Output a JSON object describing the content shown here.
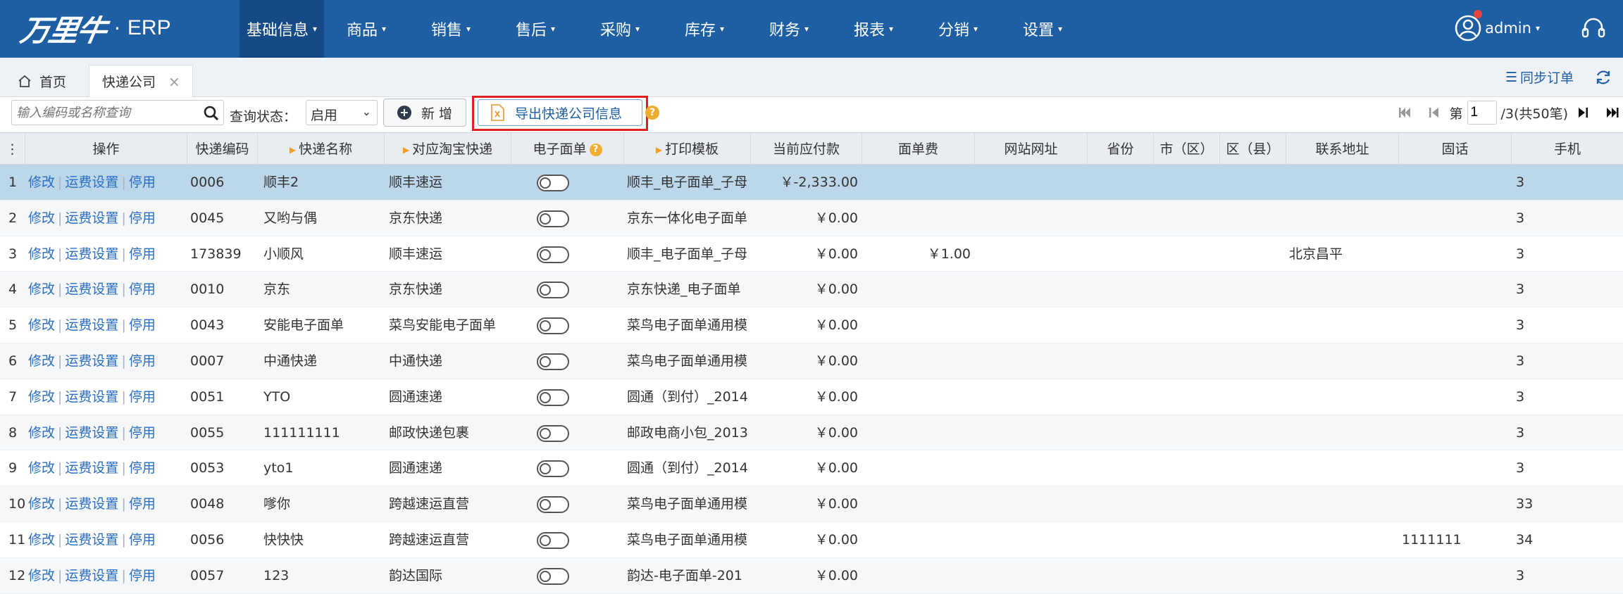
{
  "brand": {
    "logo_text": "万里牛",
    "dot": "·",
    "product": "ERP"
  },
  "nav": [
    {
      "label": "基础信息",
      "active": true
    },
    {
      "label": "商品"
    },
    {
      "label": "销售"
    },
    {
      "label": "售后"
    },
    {
      "label": "采购"
    },
    {
      "label": "库存"
    },
    {
      "label": "财务"
    },
    {
      "label": "报表"
    },
    {
      "label": "分销"
    },
    {
      "label": "设置"
    }
  ],
  "user": {
    "name": "admin"
  },
  "tabs": {
    "home": "首页",
    "active": "快递公司"
  },
  "sync_orders": "同步订单",
  "toolbar": {
    "search_placeholder": "输入编码或名称查询",
    "status_label": "查询状态：",
    "status_value": "启用",
    "add_label": "新 增",
    "export_label": "导出快递公司信息"
  },
  "pager": {
    "page_prefix": "第",
    "page_value": "1",
    "page_suffix": "/3(共50笔)"
  },
  "columns": {
    "ops": "操作",
    "code": "快递编码",
    "name": "快递名称",
    "taobao": "对应淘宝快递",
    "eface": "电子面单",
    "template": "打印模板",
    "payable": "当前应付款",
    "fee": "面单费",
    "website": "网站网址",
    "province": "省份",
    "city": "市（区）",
    "district": "区（县）",
    "address": "联系地址",
    "tel": "固话",
    "mobile": "手机"
  },
  "row_actions": {
    "edit": "修改",
    "freight": "运费设置",
    "disable": "停用"
  },
  "rows": [
    {
      "n": "1",
      "code": "0006",
      "name": "顺丰2",
      "taobao": "顺丰速运",
      "template": "顺丰_电子面单_子母",
      "payable": "￥-2,333.00",
      "fee": "",
      "address": "",
      "tel": "",
      "mobile": "3"
    },
    {
      "n": "2",
      "code": "0045",
      "name": "又哟与偶",
      "taobao": "京东快递",
      "template": "京东一体化电子面单",
      "payable": "￥0.00",
      "fee": "",
      "address": "",
      "tel": "",
      "mobile": "3"
    },
    {
      "n": "3",
      "code": "173839",
      "name": "小顺风",
      "taobao": "顺丰速运",
      "template": "顺丰_电子面单_子母",
      "payable": "￥0.00",
      "fee": "￥1.00",
      "address": "北京昌平",
      "tel": "",
      "mobile": "3"
    },
    {
      "n": "4",
      "code": "0010",
      "name": "京东",
      "taobao": "京东快递",
      "template": "京东快递_电子面单",
      "payable": "￥0.00",
      "fee": "",
      "address": "",
      "tel": "",
      "mobile": "3"
    },
    {
      "n": "5",
      "code": "0043",
      "name": "安能电子面单",
      "taobao": "菜鸟安能电子面单",
      "template": "菜鸟电子面单通用模",
      "payable": "￥0.00",
      "fee": "",
      "address": "",
      "tel": "",
      "mobile": "3"
    },
    {
      "n": "6",
      "code": "0007",
      "name": "中通快递",
      "taobao": "中通快递",
      "template": "菜鸟电子面单通用模",
      "payable": "￥0.00",
      "fee": "",
      "address": "",
      "tel": "",
      "mobile": "3"
    },
    {
      "n": "7",
      "code": "0051",
      "name": "YTO",
      "taobao": "圆通速递",
      "template": "圆通（到付）_2014",
      "payable": "￥0.00",
      "fee": "",
      "address": "",
      "tel": "",
      "mobile": "3"
    },
    {
      "n": "8",
      "code": "0055",
      "name": "111111111",
      "taobao": "邮政快递包裹",
      "template": "邮政电商小包_2013",
      "payable": "￥0.00",
      "fee": "",
      "address": "",
      "tel": "",
      "mobile": "3"
    },
    {
      "n": "9",
      "code": "0053",
      "name": "yto1",
      "taobao": "圆通速递",
      "template": "圆通（到付）_2014",
      "payable": "￥0.00",
      "fee": "",
      "address": "",
      "tel": "",
      "mobile": "3"
    },
    {
      "n": "10",
      "code": "0048",
      "name": "嗲你",
      "taobao": "跨越速运直营",
      "template": "菜鸟电子面单通用模",
      "payable": "￥0.00",
      "fee": "",
      "address": "",
      "tel": "",
      "mobile": "33"
    },
    {
      "n": "11",
      "code": "0056",
      "name": "快快快",
      "taobao": "跨越速运直营",
      "template": "菜鸟电子面单通用模",
      "payable": "￥0.00",
      "fee": "",
      "address": "",
      "tel": "1111111",
      "mobile": "34"
    },
    {
      "n": "12",
      "code": "0057",
      "name": "123",
      "taobao": "韵达国际",
      "template": "韵达-电子面单-201",
      "payable": "￥0.00",
      "fee": "",
      "address": "",
      "tel": "",
      "mobile": "3"
    }
  ]
}
